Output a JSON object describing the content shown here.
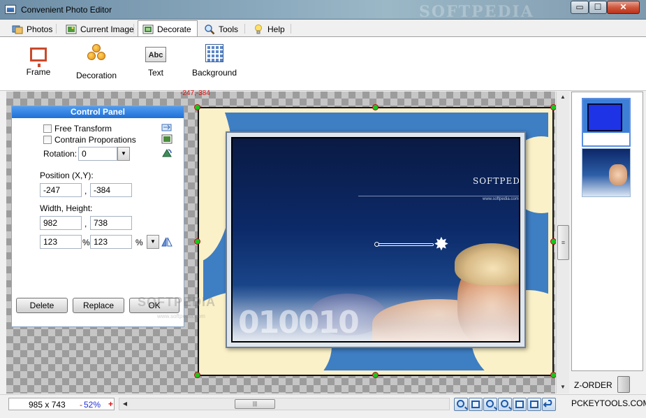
{
  "window": {
    "title": "Convenient Photo Editor",
    "watermark": "SOFTPEDIA",
    "minimize_glyph": "▭",
    "maximize_glyph": "☐",
    "close_glyph": "✕"
  },
  "tabs": [
    {
      "label": "Photos",
      "icon": "photos-icon"
    },
    {
      "label": "Current Image",
      "icon": "current-image-icon"
    },
    {
      "label": "Decorate",
      "icon": "decorate-icon",
      "active": true
    },
    {
      "label": "Tools",
      "icon": "magnifier-icon"
    },
    {
      "label": "Help",
      "icon": "lightbulb-icon"
    }
  ],
  "ribbon": {
    "frame": "Frame",
    "decoration": "Decoration",
    "text": "Text",
    "text_icon_label": "Abc",
    "background": "Background"
  },
  "canvas": {
    "coord_label": "-247,-384"
  },
  "picture": {
    "logo_text": "SOFTPEDIA",
    "logo_url": "www.softpedia.com",
    "digits_text": "010010"
  },
  "control_panel": {
    "title": "Control Panel",
    "free_transform": "Free Transform",
    "contrain_proporations": "Contrain Proporations",
    "rotation_label": "Rotation:",
    "rotation_value": "0",
    "position_label": "Position  (X,Y):",
    "position_x": "-247",
    "position_y": "-384",
    "wh_label": "Width, Height:",
    "width": "982",
    "height": "738",
    "width_pct": "123",
    "height_pct": "123",
    "comma": ",",
    "pct_sign": "%,",
    "pct_sign2": "%",
    "delete": "Delete",
    "replace": "Replace",
    "ok": "OK",
    "watermark": "SOFTPEDIA",
    "watermark_url": "www.softpedia.com"
  },
  "sidebar": {
    "zorder_label": "Z-ORDER"
  },
  "status": {
    "dimensions": "985 x 743",
    "zoom_minus": "-",
    "zoom": "52%",
    "zoom_plus": "+",
    "brand": "PCKEYTOOLS.COM"
  },
  "colors": {
    "accent_header": "#1f6fd6",
    "handle_fill": "#1cc41c",
    "handle_border": "#b81010",
    "coord_text": "#d41414"
  }
}
